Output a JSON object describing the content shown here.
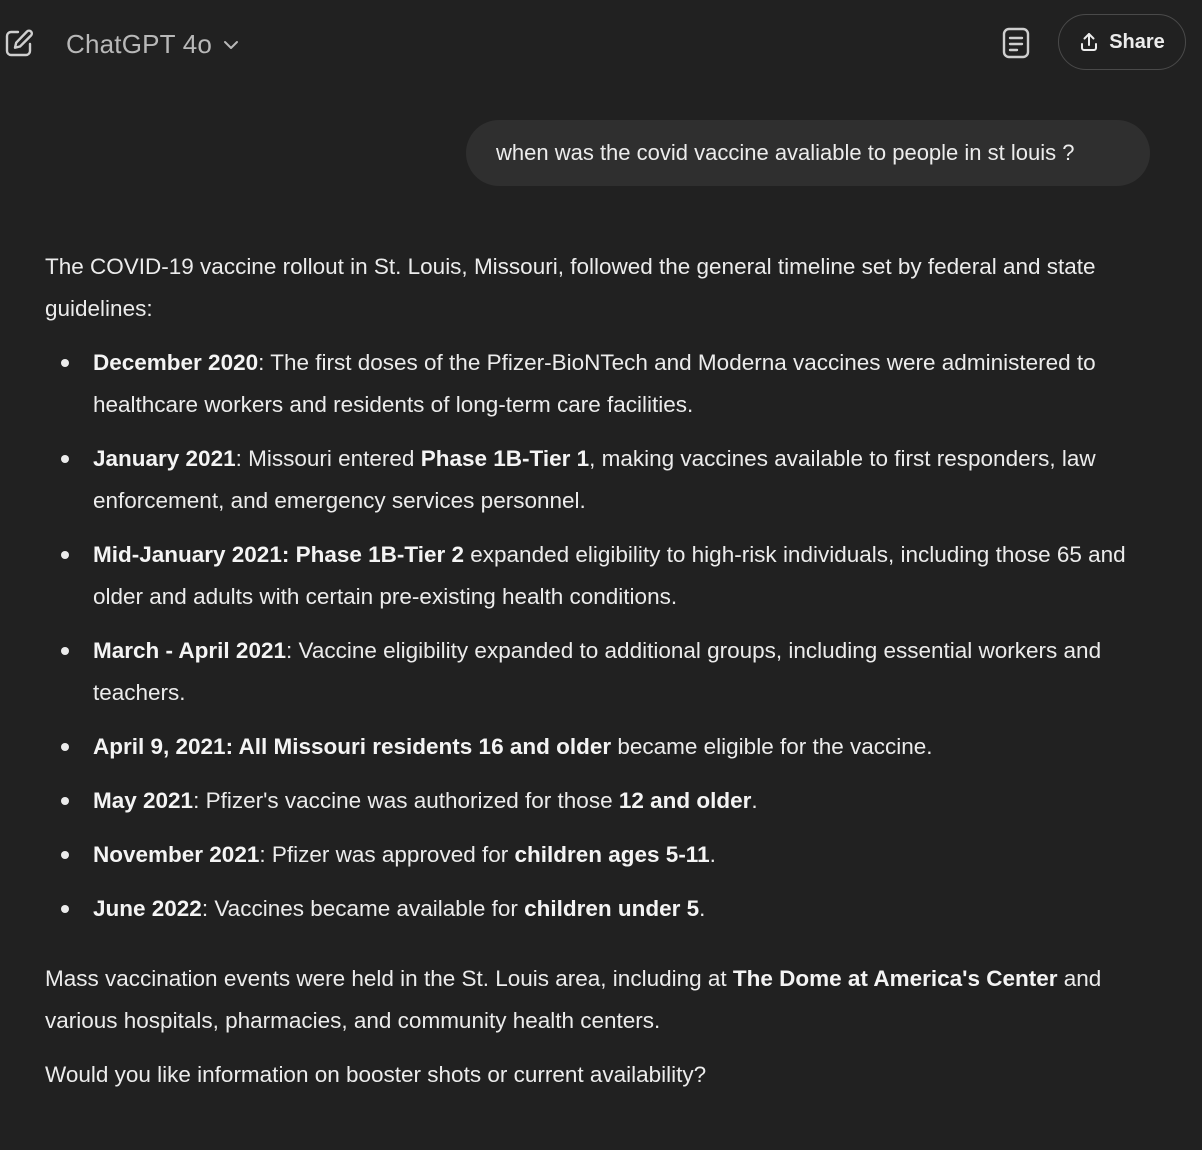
{
  "header": {
    "model_name": "ChatGPT 4o",
    "share_label": "Share",
    "icons": {
      "new_chat": "edit-pencil-icon",
      "model_dropdown": "chevron-down-icon",
      "canvas": "document-icon",
      "share": "upload-icon"
    }
  },
  "user_message": "when was the covid vaccine avaliable to people in st louis ?",
  "assistant": {
    "intro": "The COVID-19 vaccine rollout in St. Louis, Missouri, followed the general timeline set by federal and state guidelines:",
    "items": [
      {
        "date": "December 2020",
        "sep": ": ",
        "t1": "The first doses of the Pfizer-BioNTech and Moderna vaccines were administered to healthcare workers and residents of long-term care facilities."
      },
      {
        "date": "January 2021",
        "sep": ": ",
        "t1": "Missouri entered ",
        "b1": "Phase 1B-Tier 1",
        "t2": ", making vaccines available to first responders, law enforcement, and emergency services personnel."
      },
      {
        "date": "Mid-January 2021",
        "sep": ": ",
        "b1": "Phase 1B-Tier 2",
        "t2": " expanded eligibility to high-risk individuals, including those 65 and older and adults with certain pre-existing health conditions."
      },
      {
        "date": "March - April 2021",
        "sep": ": ",
        "t1": "Vaccine eligibility expanded to additional groups, including essential workers and teachers."
      },
      {
        "date": "April 9, 2021",
        "sep": ": ",
        "b1": "All Missouri residents 16 and older",
        "t2": " became eligible for the vaccine."
      },
      {
        "date": "May 2021",
        "sep": ": ",
        "t1": "Pfizer's vaccine was authorized for those ",
        "b1": "12 and older",
        "t2": "."
      },
      {
        "date": "November 2021",
        "sep": ": ",
        "t1": "Pfizer was approved for ",
        "b1": "children ages 5-11",
        "t2": "."
      },
      {
        "date": "June 2022",
        "sep": ": ",
        "t1": "Vaccines became available for ",
        "b1": "children under 5",
        "t2": "."
      }
    ],
    "closing_1": {
      "t1": "Mass vaccination events were held in the St. Louis area, including at ",
      "b1": "The Dome at America's Center",
      "t2": " and various hospitals, pharmacies, and community health centers."
    },
    "closing_2": "Would you like information on booster shots or current availability?"
  }
}
